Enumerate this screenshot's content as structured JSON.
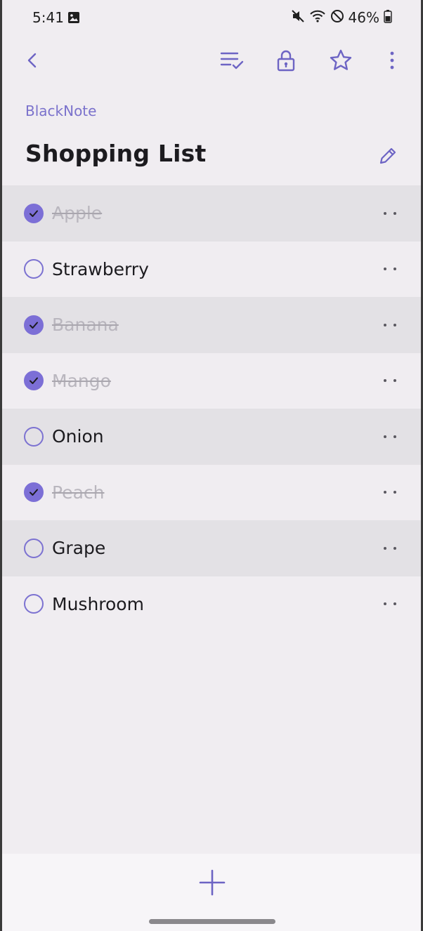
{
  "status_bar": {
    "time": "5:41",
    "battery": "46%",
    "icons": [
      "image-icon",
      "mute-icon",
      "wifi-icon",
      "do-not-disturb-icon",
      "battery-icon"
    ]
  },
  "toolbar": {
    "icons": [
      "back-icon",
      "checklist-icon",
      "lock-icon",
      "star-icon",
      "more-vert-icon"
    ]
  },
  "header": {
    "app_name": "BlackNote",
    "title": "Shopping List"
  },
  "items": [
    {
      "label": "Apple",
      "checked": true
    },
    {
      "label": "Strawberry",
      "checked": false
    },
    {
      "label": "Banana",
      "checked": true
    },
    {
      "label": "Mango",
      "checked": true
    },
    {
      "label": "Onion",
      "checked": false
    },
    {
      "label": "Peach",
      "checked": true
    },
    {
      "label": "Grape",
      "checked": false
    },
    {
      "label": "Mushroom",
      "checked": false
    }
  ],
  "colors": {
    "accent": "#7c6fd6",
    "background": "#f0edf1",
    "row_shade": "#e3e1e5",
    "done_text": "#b9b6be"
  }
}
